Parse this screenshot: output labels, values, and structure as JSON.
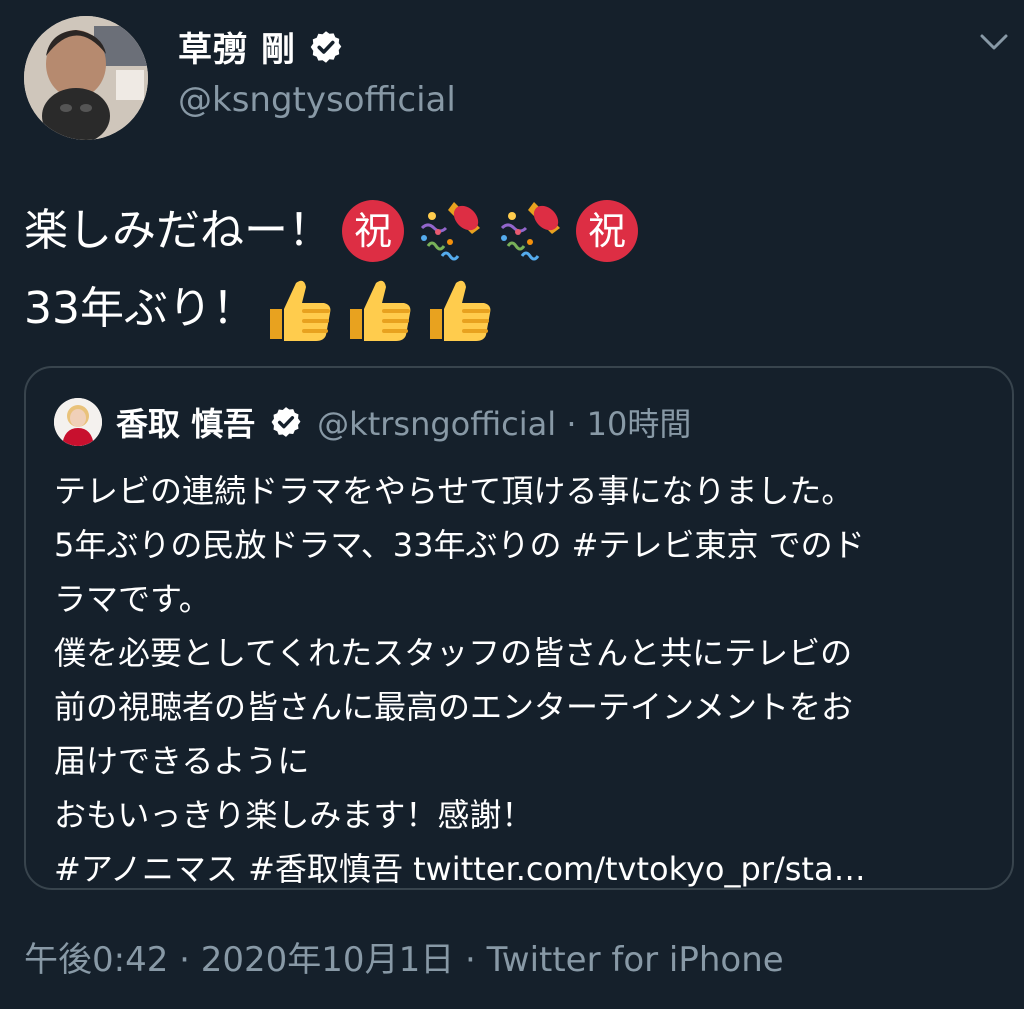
{
  "author": {
    "name": "草彅 剛",
    "handle": "@ksngtysofficial"
  },
  "tweet": {
    "line1": "楽しみだねー！",
    "line2": "33年ぶり！",
    "emojis_line1": [
      "congratulation-ideograph-icon",
      "party-popper-icon",
      "party-popper-icon",
      "congratulation-ideograph-icon"
    ],
    "emojis_line2": [
      "thumbs-up-icon",
      "thumbs-up-icon",
      "thumbs-up-icon"
    ]
  },
  "quoted_tweet": {
    "name": "香取 慎吾",
    "handle": "@ktrsngofficial",
    "time": " · 10時間",
    "lines": [
      "テレビの連続ドラマをやらせて頂ける事になりました。",
      "5年ぶりの民放ドラマ、33年ぶりの #テレビ東京 でのド",
      "ラマです。",
      "僕を必要としてくれたスタッフの皆さんと共にテレビの",
      "前の視聴者の皆さんに最高のエンターテインメントをお",
      "届けできるように",
      "おもいっきり楽しみます！感謝！",
      "#アノニマス #香取慎吾 twitter.com/tvtokyo_pr/sta…"
    ]
  },
  "meta": {
    "text": "午後0:42 · 2020年10月1日 · Twitter for iPhone"
  },
  "colors": {
    "background": "#15202b",
    "secondary_text": "#8899a6",
    "border": "#38444d",
    "verified_badge": "#ffffff"
  }
}
